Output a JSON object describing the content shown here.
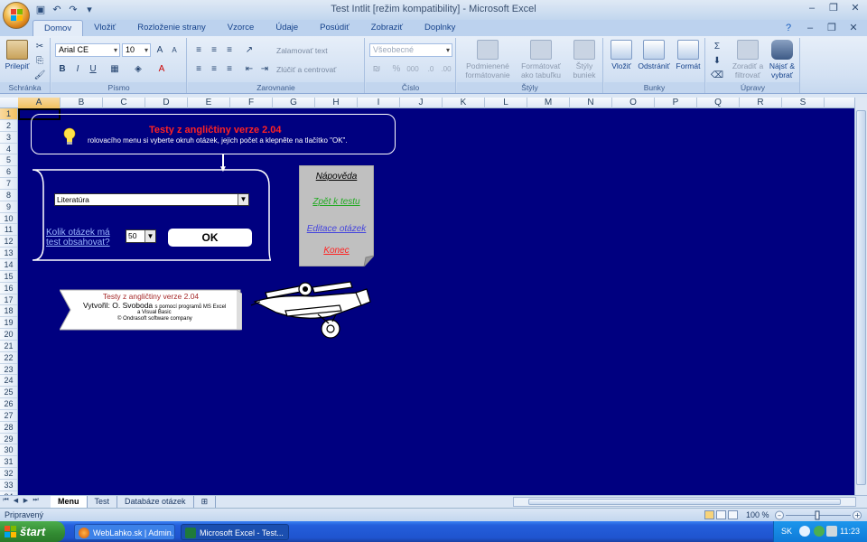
{
  "window": {
    "title": "Test Intlit  [režim kompatibility] - Microsoft Excel"
  },
  "ribbon": {
    "tabs": [
      "Domov",
      "Vložiť",
      "Rozloženie strany",
      "Vzorce",
      "Údaje",
      "Posúdiť",
      "Zobraziť",
      "Doplnky"
    ],
    "groups": {
      "clipboard": "Schránka",
      "font": "Písmo",
      "alignment": "Zarovnanie",
      "number": "Číslo",
      "styles": "Štýly",
      "cells": "Bunky",
      "editing": "Úpravy"
    },
    "paste_label": "Prilepiť",
    "font_name": "Arial CE",
    "font_size": "10",
    "wrap_text": "Zalamovať text",
    "merge_center": "Zlúčiť a centrovať",
    "number_format": "Všeobecné",
    "cond_format": [
      "Podmienené",
      "formátovanie"
    ],
    "format_table": [
      "Formátovať",
      "ako tabuľku"
    ],
    "cell_styles": [
      "Štýly",
      "buniek"
    ],
    "insert": "Vložiť",
    "delete": "Odstrániť",
    "format": "Formát",
    "sort_filter": [
      "Zoradiť a",
      "filtrovať"
    ],
    "find_select": [
      "Nájsť &",
      "vybrať"
    ]
  },
  "grid": {
    "columns": [
      "A",
      "B",
      "C",
      "D",
      "E",
      "F",
      "G",
      "H",
      "I",
      "J",
      "K",
      "L",
      "M",
      "N",
      "O",
      "P",
      "Q",
      "R",
      "S"
    ],
    "rows": [
      "1",
      "2",
      "3",
      "4",
      "5",
      "6",
      "7",
      "8",
      "9",
      "10",
      "11",
      "12",
      "13",
      "14",
      "15",
      "16",
      "17",
      "18",
      "19",
      "20",
      "21",
      "22",
      "23",
      "24",
      "25",
      "26",
      "27",
      "28",
      "29",
      "30",
      "31",
      "32",
      "33",
      "34"
    ],
    "selected_cell": "A1"
  },
  "sheet_content": {
    "banner_title": "Testy z angličtiny verze 2.04",
    "banner_text": "rolovacího menu si vyberte okruh otázek, jejich počet a klepněte na tlačítko \"OK\".",
    "topic_value": "Literatúra",
    "question_count_label": [
      "Kolik otázek má",
      "test obsahovat?"
    ],
    "question_count_value": "50",
    "ok_label": "OK",
    "nav": {
      "help": "Nápověda",
      "back": "Zpět k testu",
      "edit": "Editace otázek",
      "end": "Konec"
    },
    "nav_colors": {
      "help": "#000000",
      "back": "#22aa22",
      "edit": "#4444dd",
      "end": "#ff2222"
    },
    "credits": {
      "title": "Testy z angličtiny verze 2.04",
      "author_prefix": "Vytvořil: O. Svoboda",
      "author_suffix": "s pomocí programů MS Excel",
      "line2": "a Visual Basic",
      "line3": "© Ondrasoft software company"
    }
  },
  "sheet_tabs": [
    "Menu",
    "Test",
    "Databáze otázek"
  ],
  "status": {
    "ready": "Pripravený",
    "zoom": "100 %"
  },
  "taskbar": {
    "start": "štart",
    "tasks": [
      "WebLahko.sk | Admin...",
      "Microsoft Excel - Test..."
    ],
    "lang": "SK",
    "clock": "11:23"
  },
  "colors": {
    "sheet_background": "#000080",
    "accent_red": "#ff2222"
  }
}
